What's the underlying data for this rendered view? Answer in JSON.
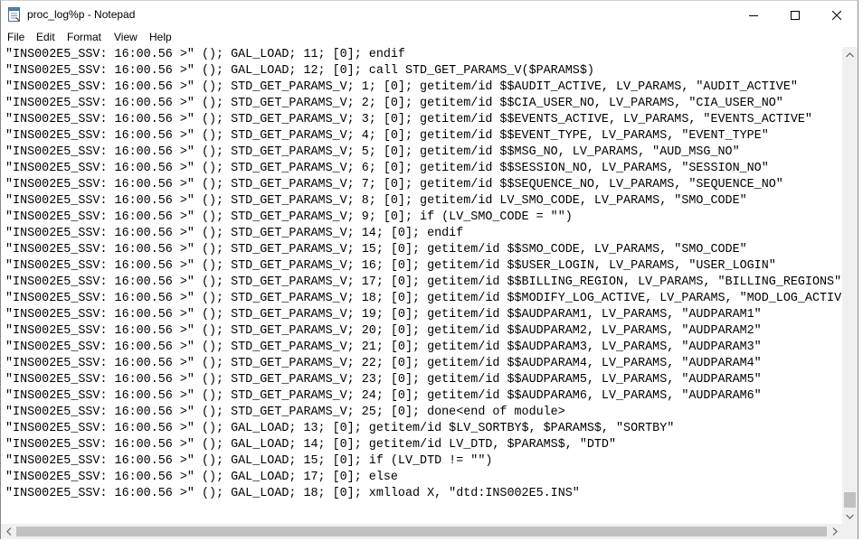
{
  "window": {
    "title": "proc_log%p - Notepad",
    "accent": "#000000"
  },
  "icons": {
    "app": "notepad-icon",
    "minimize": "minimize-icon",
    "maximize": "maximize-icon",
    "close": "close-icon"
  },
  "menu": {
    "items": [
      {
        "label": "File"
      },
      {
        "label": "Edit"
      },
      {
        "label": "Format"
      },
      {
        "label": "View"
      },
      {
        "label": "Help"
      }
    ]
  },
  "editor": {
    "lines": [
      "\"INS002E5_SSV: 16:00.56 >\" (); GAL_LOAD; 11; [0]; endif",
      "\"INS002E5_SSV: 16:00.56 >\" (); GAL_LOAD; 12; [0]; call STD_GET_PARAMS_V($PARAMS$)",
      "\"INS002E5_SSV: 16:00.56 >\" (); STD_GET_PARAMS_V; 1; [0]; getitem/id $$AUDIT_ACTIVE, LV_PARAMS, \"AUDIT_ACTIVE\"",
      "\"INS002E5_SSV: 16:00.56 >\" (); STD_GET_PARAMS_V; 2; [0]; getitem/id $$CIA_USER_NO, LV_PARAMS, \"CIA_USER_NO\"",
      "\"INS002E5_SSV: 16:00.56 >\" (); STD_GET_PARAMS_V; 3; [0]; getitem/id $$EVENTS_ACTIVE, LV_PARAMS, \"EVENTS_ACTIVE\"",
      "\"INS002E5_SSV: 16:00.56 >\" (); STD_GET_PARAMS_V; 4; [0]; getitem/id $$EVENT_TYPE, LV_PARAMS, \"EVENT_TYPE\"",
      "\"INS002E5_SSV: 16:00.56 >\" (); STD_GET_PARAMS_V; 5; [0]; getitem/id $$MSG_NO, LV_PARAMS, \"AUD_MSG_NO\"",
      "\"INS002E5_SSV: 16:00.56 >\" (); STD_GET_PARAMS_V; 6; [0]; getitem/id $$SESSION_NO, LV_PARAMS, \"SESSION_NO\"",
      "\"INS002E5_SSV: 16:00.56 >\" (); STD_GET_PARAMS_V; 7; [0]; getitem/id $$SEQUENCE_NO, LV_PARAMS, \"SEQUENCE_NO\"",
      "\"INS002E5_SSV: 16:00.56 >\" (); STD_GET_PARAMS_V; 8; [0]; getitem/id LV_SMO_CODE, LV_PARAMS, \"SMO_CODE\"",
      "\"INS002E5_SSV: 16:00.56 >\" (); STD_GET_PARAMS_V; 9; [0]; if (LV_SMO_CODE = \"\")",
      "\"INS002E5_SSV: 16:00.56 >\" (); STD_GET_PARAMS_V; 14; [0]; endif",
      "\"INS002E5_SSV: 16:00.56 >\" (); STD_GET_PARAMS_V; 15; [0]; getitem/id $$SMO_CODE, LV_PARAMS, \"SMO_CODE\"",
      "\"INS002E5_SSV: 16:00.56 >\" (); STD_GET_PARAMS_V; 16; [0]; getitem/id $$USER_LOGIN, LV_PARAMS, \"USER_LOGIN\"",
      "\"INS002E5_SSV: 16:00.56 >\" (); STD_GET_PARAMS_V; 17; [0]; getitem/id $$BILLING_REGION, LV_PARAMS, \"BILLING_REGIONS\"",
      "\"INS002E5_SSV: 16:00.56 >\" (); STD_GET_PARAMS_V; 18; [0]; getitem/id $$MODIFY_LOG_ACTIVE, LV_PARAMS, \"MOD_LOG_ACTIVE",
      "\"INS002E5_SSV: 16:00.56 >\" (); STD_GET_PARAMS_V; 19; [0]; getitem/id $$AUDPARAM1, LV_PARAMS, \"AUDPARAM1\"",
      "\"INS002E5_SSV: 16:00.56 >\" (); STD_GET_PARAMS_V; 20; [0]; getitem/id $$AUDPARAM2, LV_PARAMS, \"AUDPARAM2\"",
      "\"INS002E5_SSV: 16:00.56 >\" (); STD_GET_PARAMS_V; 21; [0]; getitem/id $$AUDPARAM3, LV_PARAMS, \"AUDPARAM3\"",
      "\"INS002E5_SSV: 16:00.56 >\" (); STD_GET_PARAMS_V; 22; [0]; getitem/id $$AUDPARAM4, LV_PARAMS, \"AUDPARAM4\"",
      "\"INS002E5_SSV: 16:00.56 >\" (); STD_GET_PARAMS_V; 23; [0]; getitem/id $$AUDPARAM5, LV_PARAMS, \"AUDPARAM5\"",
      "\"INS002E5_SSV: 16:00.56 >\" (); STD_GET_PARAMS_V; 24; [0]; getitem/id $$AUDPARAM6, LV_PARAMS, \"AUDPARAM6\"",
      "\"INS002E5_SSV: 16:00.56 >\" (); STD_GET_PARAMS_V; 25; [0]; done<end of module>",
      "\"INS002E5_SSV: 16:00.56 >\" (); GAL_LOAD; 13; [0]; getitem/id $LV_SORTBY$, $PARAMS$, \"SORTBY\"",
      "\"INS002E5_SSV: 16:00.56 >\" (); GAL_LOAD; 14; [0]; getitem/id LV_DTD, $PARAMS$, \"DTD\"",
      "\"INS002E5_SSV: 16:00.56 >\" (); GAL_LOAD; 15; [0]; if (LV_DTD != \"\")",
      "\"INS002E5_SSV: 16:00.56 >\" (); GAL_LOAD; 17; [0]; else",
      "\"INS002E5_SSV: 16:00.56 >\" (); GAL_LOAD; 18; [0]; xmlload X, \"dtd:INS002E5.INS\""
    ]
  },
  "scrollbars": {
    "vertical_position": 0.97,
    "horizontal_position": 0.0
  }
}
